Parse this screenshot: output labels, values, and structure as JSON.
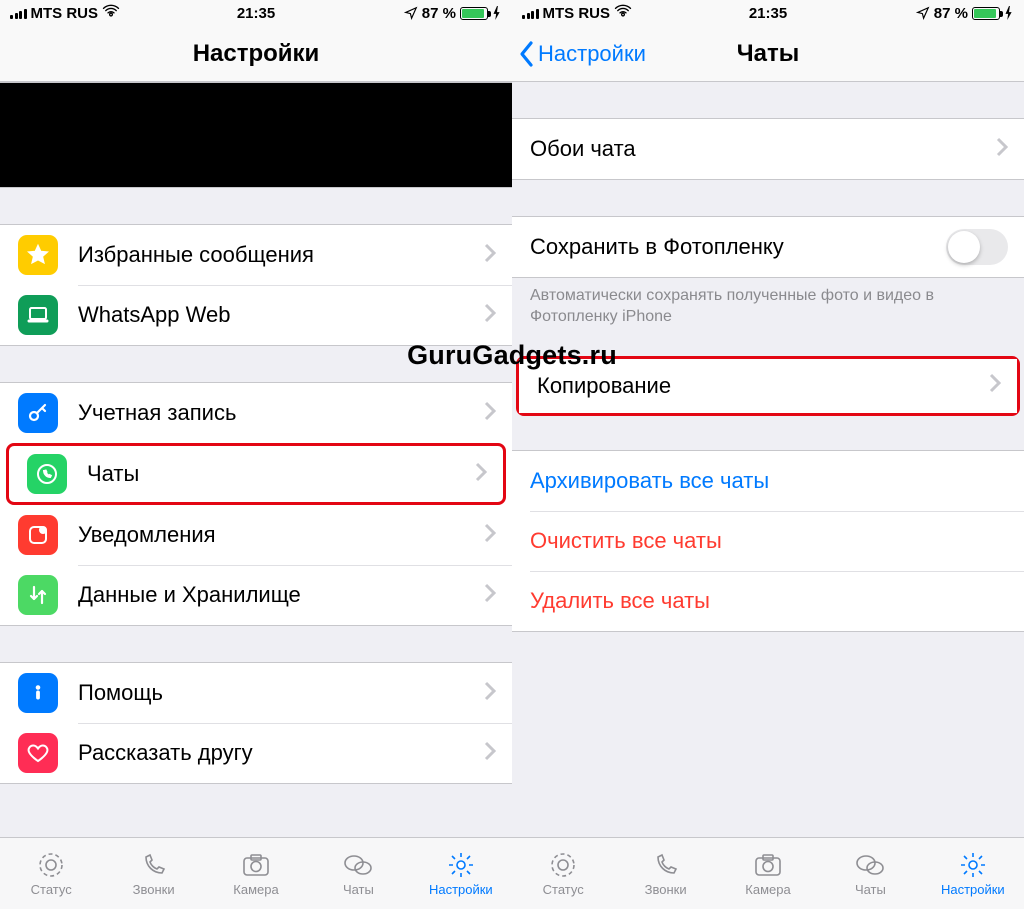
{
  "watermark": "GuruGadgets.ru",
  "status": {
    "carrier": "MTS RUS",
    "time": "21:35",
    "battery": "87 %"
  },
  "left": {
    "title": "Настройки",
    "items1": [
      {
        "label": "Избранные сообщения"
      },
      {
        "label": "WhatsApp Web"
      }
    ],
    "items2": [
      {
        "label": "Учетная запись"
      },
      {
        "label": "Чаты"
      },
      {
        "label": "Уведомления"
      },
      {
        "label": "Данные и Хранилище"
      }
    ],
    "items3": [
      {
        "label": "Помощь"
      },
      {
        "label": "Рассказать другу"
      }
    ]
  },
  "right": {
    "back": "Настройки",
    "title": "Чаты",
    "wallpaper": "Обои чата",
    "savePhotos": "Сохранить в Фотопленку",
    "savePhotosHint": "Автоматически сохранять полученные фото и видео в Фотопленку iPhone",
    "backup": "Копирование",
    "archive": "Архивировать все чаты",
    "clear": "Очистить все чаты",
    "delete": "Удалить все чаты"
  },
  "tabs": {
    "status": "Статус",
    "calls": "Звонки",
    "camera": "Камера",
    "chats": "Чаты",
    "settings": "Настройки"
  }
}
